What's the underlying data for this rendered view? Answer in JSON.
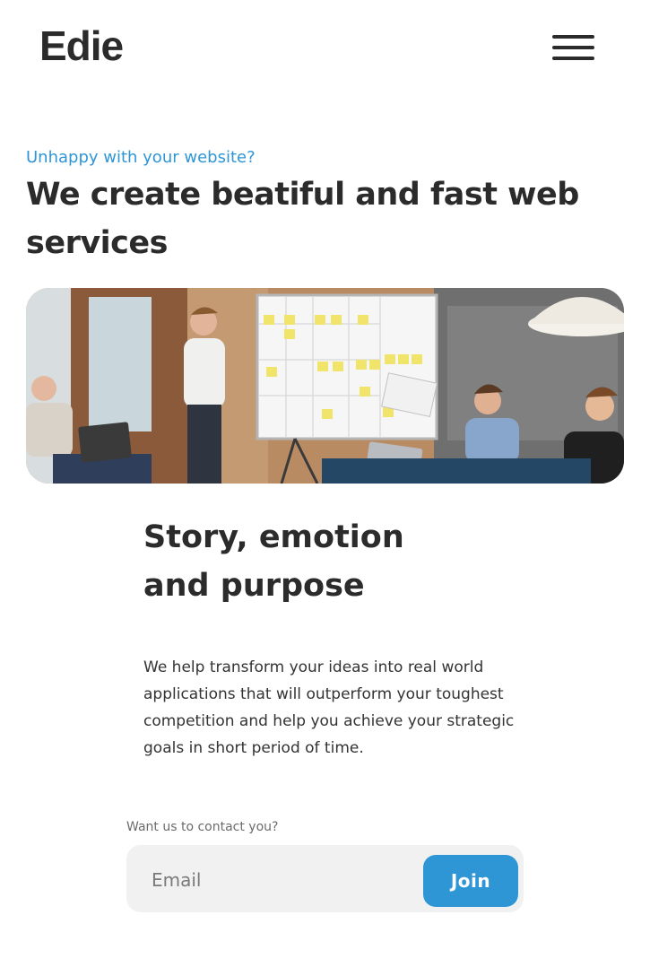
{
  "header": {
    "logo": "Edie",
    "menu_icon": "hamburger-menu-icon"
  },
  "hero": {
    "eyebrow": "Unhappy with your website?",
    "headline": "We create beatiful and fast web services",
    "image_icon": "office-meeting-photo"
  },
  "story": {
    "title_line1": "Story, emotion",
    "title_line2": "and purpose",
    "body": "We help transform your ideas into real world applications that will outperform your toughest competition and help you achieve your strategic goals in short period of time."
  },
  "contact": {
    "label": "Want us to contact you?",
    "email_placeholder": "Email",
    "join_label": "Join"
  },
  "colors": {
    "accent": "#2f96d6",
    "text": "#2b2b2b",
    "input_bg": "#f1f1f1"
  }
}
